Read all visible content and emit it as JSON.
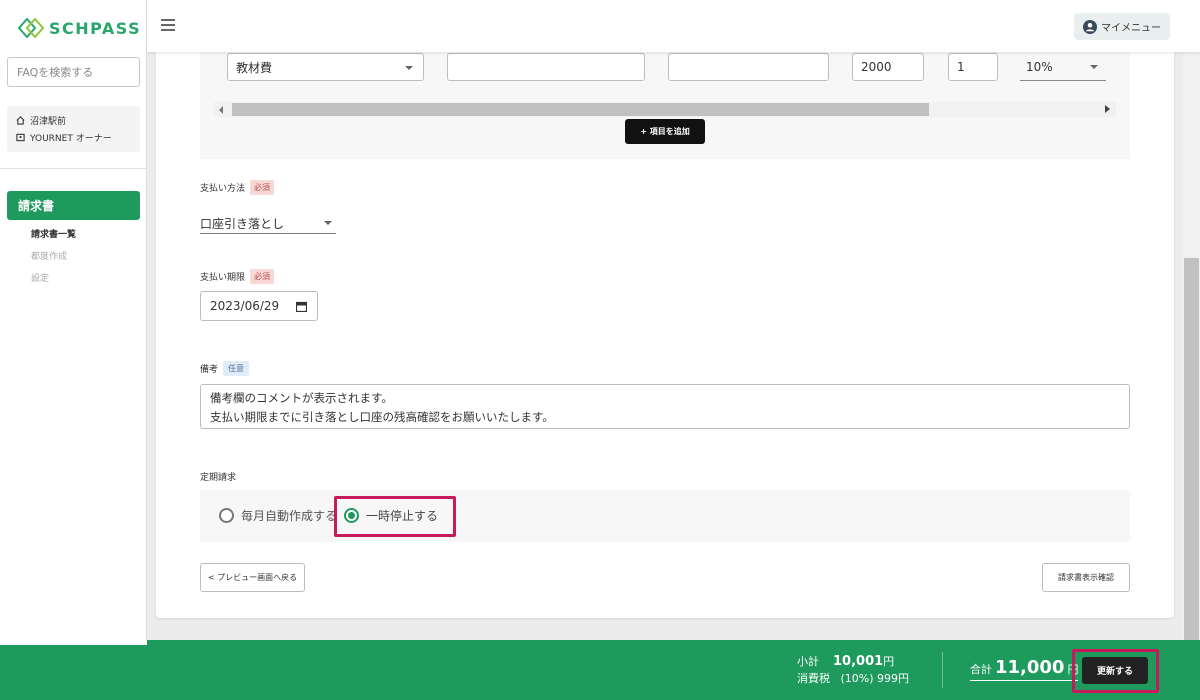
{
  "brand": {
    "name": "SCHPASS",
    "color": "#2aa56b"
  },
  "sidebar": {
    "faq_placeholder": "FAQを検索する",
    "org": {
      "school": "沼津駅前",
      "role": "YOURNET オーナー"
    },
    "nav_active": "請求書",
    "subnav": [
      "請求書一覧",
      "都度作成",
      "設定"
    ]
  },
  "header": {
    "mymenu_label": "マイメニュー"
  },
  "item_row": {
    "item_type": "教材費",
    "name": "",
    "note": "",
    "price": "2000",
    "quantity": "1",
    "tax_rate": "10%",
    "add_button": "+ 項目を追加"
  },
  "payment_method": {
    "label": "支払い方法",
    "badge": "必須",
    "value": "口座引き落とし"
  },
  "due_date": {
    "label": "支払い期限",
    "badge": "必須",
    "value": "2023/06/29"
  },
  "remarks": {
    "label": "備考",
    "badge": "任意",
    "line1": "備考欄のコメントが表示されます。",
    "line2": "支払い期限までに引き落とし口座の残高確認をお願いいたします。"
  },
  "recurring": {
    "label": "定期請求",
    "options": [
      "毎月自動作成する",
      "一時停止する"
    ],
    "selected": "一時停止する"
  },
  "buttons": {
    "back": "< プレビュー画面へ戻る",
    "confirm": "請求書表示確認",
    "update": "更新する"
  },
  "summary": {
    "subtotal_label": "小計",
    "subtotal_value": "10,001",
    "tax_label": "消費税",
    "tax_rate": "(10%)",
    "tax_value": "999",
    "total_label": "合計",
    "total_value": "11,000",
    "currency": "円"
  },
  "colors": {
    "primary": "#1d9a5c",
    "highlight": "#c8195c"
  }
}
